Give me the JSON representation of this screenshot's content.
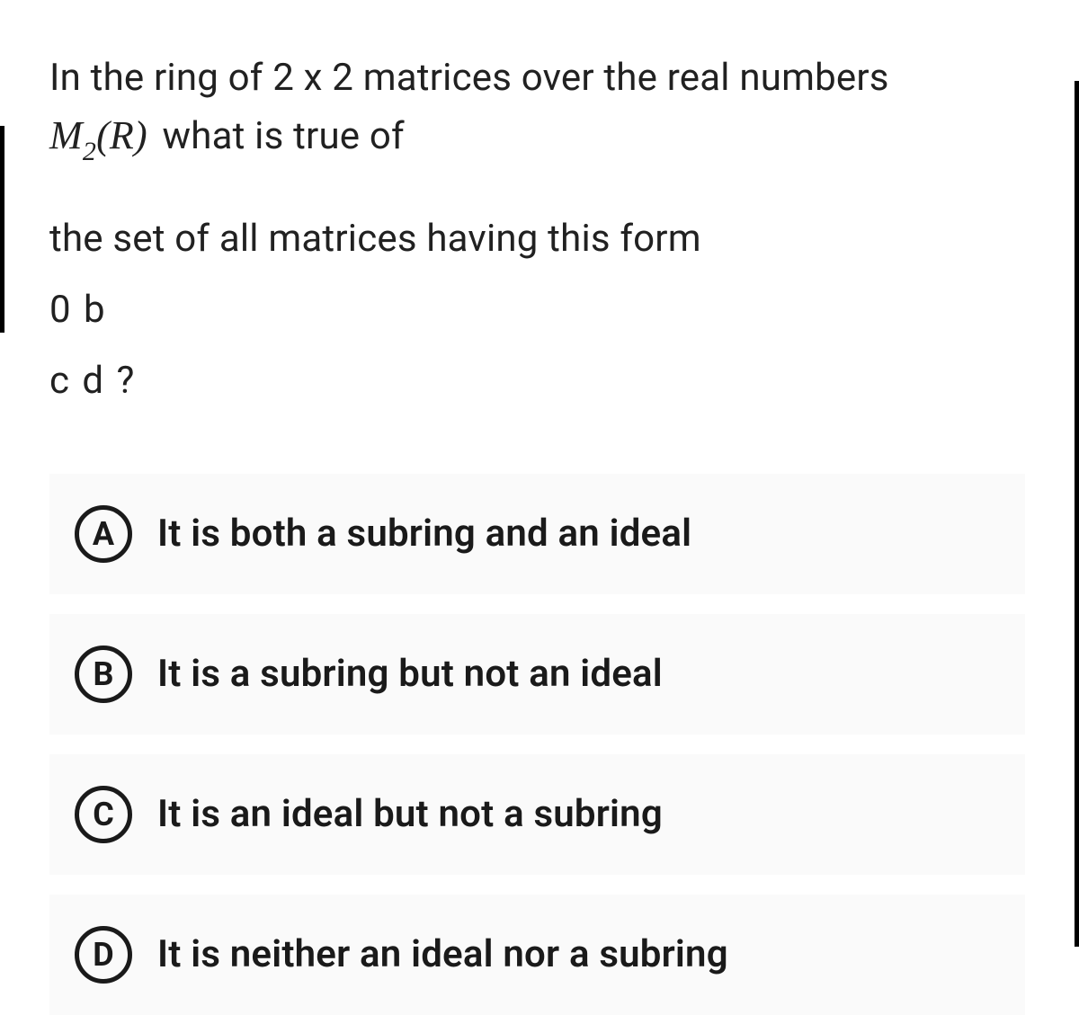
{
  "question": {
    "line1": "In the ring of 2 x 2 matrices over the real numbers",
    "math_prefix_M": "M",
    "math_sub": "2",
    "math_paren": "(R)",
    "line1_suffix": " what is true of",
    "line2": "the set of all matrices having this form",
    "matrix_row1": "0 b",
    "matrix_row2": "c d ?"
  },
  "options": [
    {
      "letter": "A",
      "text": "It is both a subring and an ideal"
    },
    {
      "letter": "B",
      "text": "It is a subring but not an ideal"
    },
    {
      "letter": "C",
      "text": "It is an ideal but not a subring"
    },
    {
      "letter": "D",
      "text": "It is neither an ideal nor a subring"
    }
  ]
}
